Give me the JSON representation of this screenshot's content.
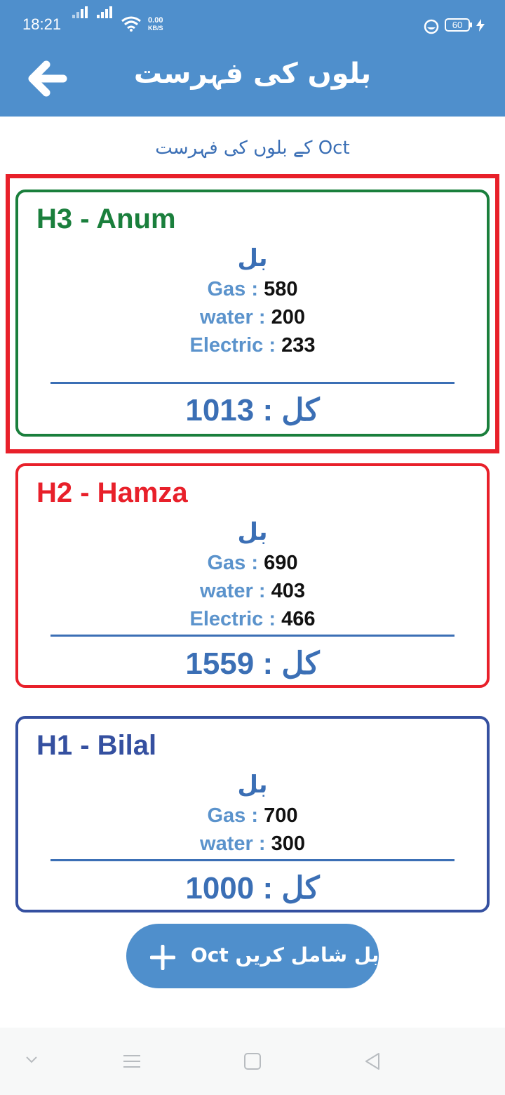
{
  "status_bar": {
    "time": "18:21",
    "net_speed_value": "0.00",
    "net_speed_unit": "KB/S",
    "battery": "60"
  },
  "app_bar": {
    "title": "بلوں کی فہرست"
  },
  "subtitle": "Oct کے بلوں کی فہرست",
  "bill_heading": "بل",
  "total_label": "کل",
  "cards": [
    {
      "name": "H3 - Anum",
      "color": "#1a7f3c",
      "rows": [
        {
          "label": "Gas",
          "value": "580"
        },
        {
          "label": "water",
          "value": "200"
        },
        {
          "label": "Electric",
          "value": "233"
        }
      ],
      "total": "1013",
      "highlighted": true
    },
    {
      "name": "H2 - Hamza",
      "color": "#e8202a",
      "rows": [
        {
          "label": "Gas",
          "value": "690"
        },
        {
          "label": "water",
          "value": "403"
        },
        {
          "label": "Electric",
          "value": "466"
        }
      ],
      "total": "1559",
      "highlighted": false
    },
    {
      "name": "H1 - Bilal",
      "color": "#3550a0",
      "rows": [
        {
          "label": "Gas",
          "value": "700"
        },
        {
          "label": "water",
          "value": "300"
        }
      ],
      "total": "1000",
      "highlighted": false
    }
  ],
  "add_button": {
    "month": "Oct",
    "label": "کا بل شامل کریں"
  },
  "colors": {
    "app_bar": "#4f8fcc",
    "text_blue": "#3b6fb5",
    "highlight": "#e8202a"
  },
  "icons": {
    "back": "arrow-left-icon",
    "add": "plus-icon"
  }
}
